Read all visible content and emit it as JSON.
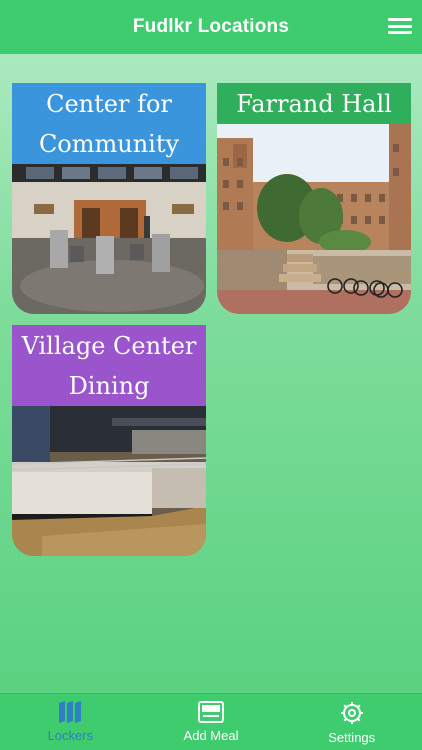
{
  "navbar": {
    "title": "Fudlkr Locations",
    "menu_icon": "hamburger-menu-icon"
  },
  "locations": [
    {
      "name": "Center for Community",
      "header_color": "#3a95dd"
    },
    {
      "name": "Farrand Hall",
      "header_color": "#2fae5c"
    },
    {
      "name": "Village Center Dining",
      "header_color": "#9b55cc"
    }
  ],
  "tabbar": {
    "active": "Lockers",
    "tabs": [
      {
        "label": "Lockers",
        "icon": "lockers-icon"
      },
      {
        "label": "Add Meal",
        "icon": "add-meal-icon"
      },
      {
        "label": "Settings",
        "icon": "gear-icon"
      }
    ],
    "active_color": "#2f7fc4",
    "inactive_color": "#ffffff"
  }
}
